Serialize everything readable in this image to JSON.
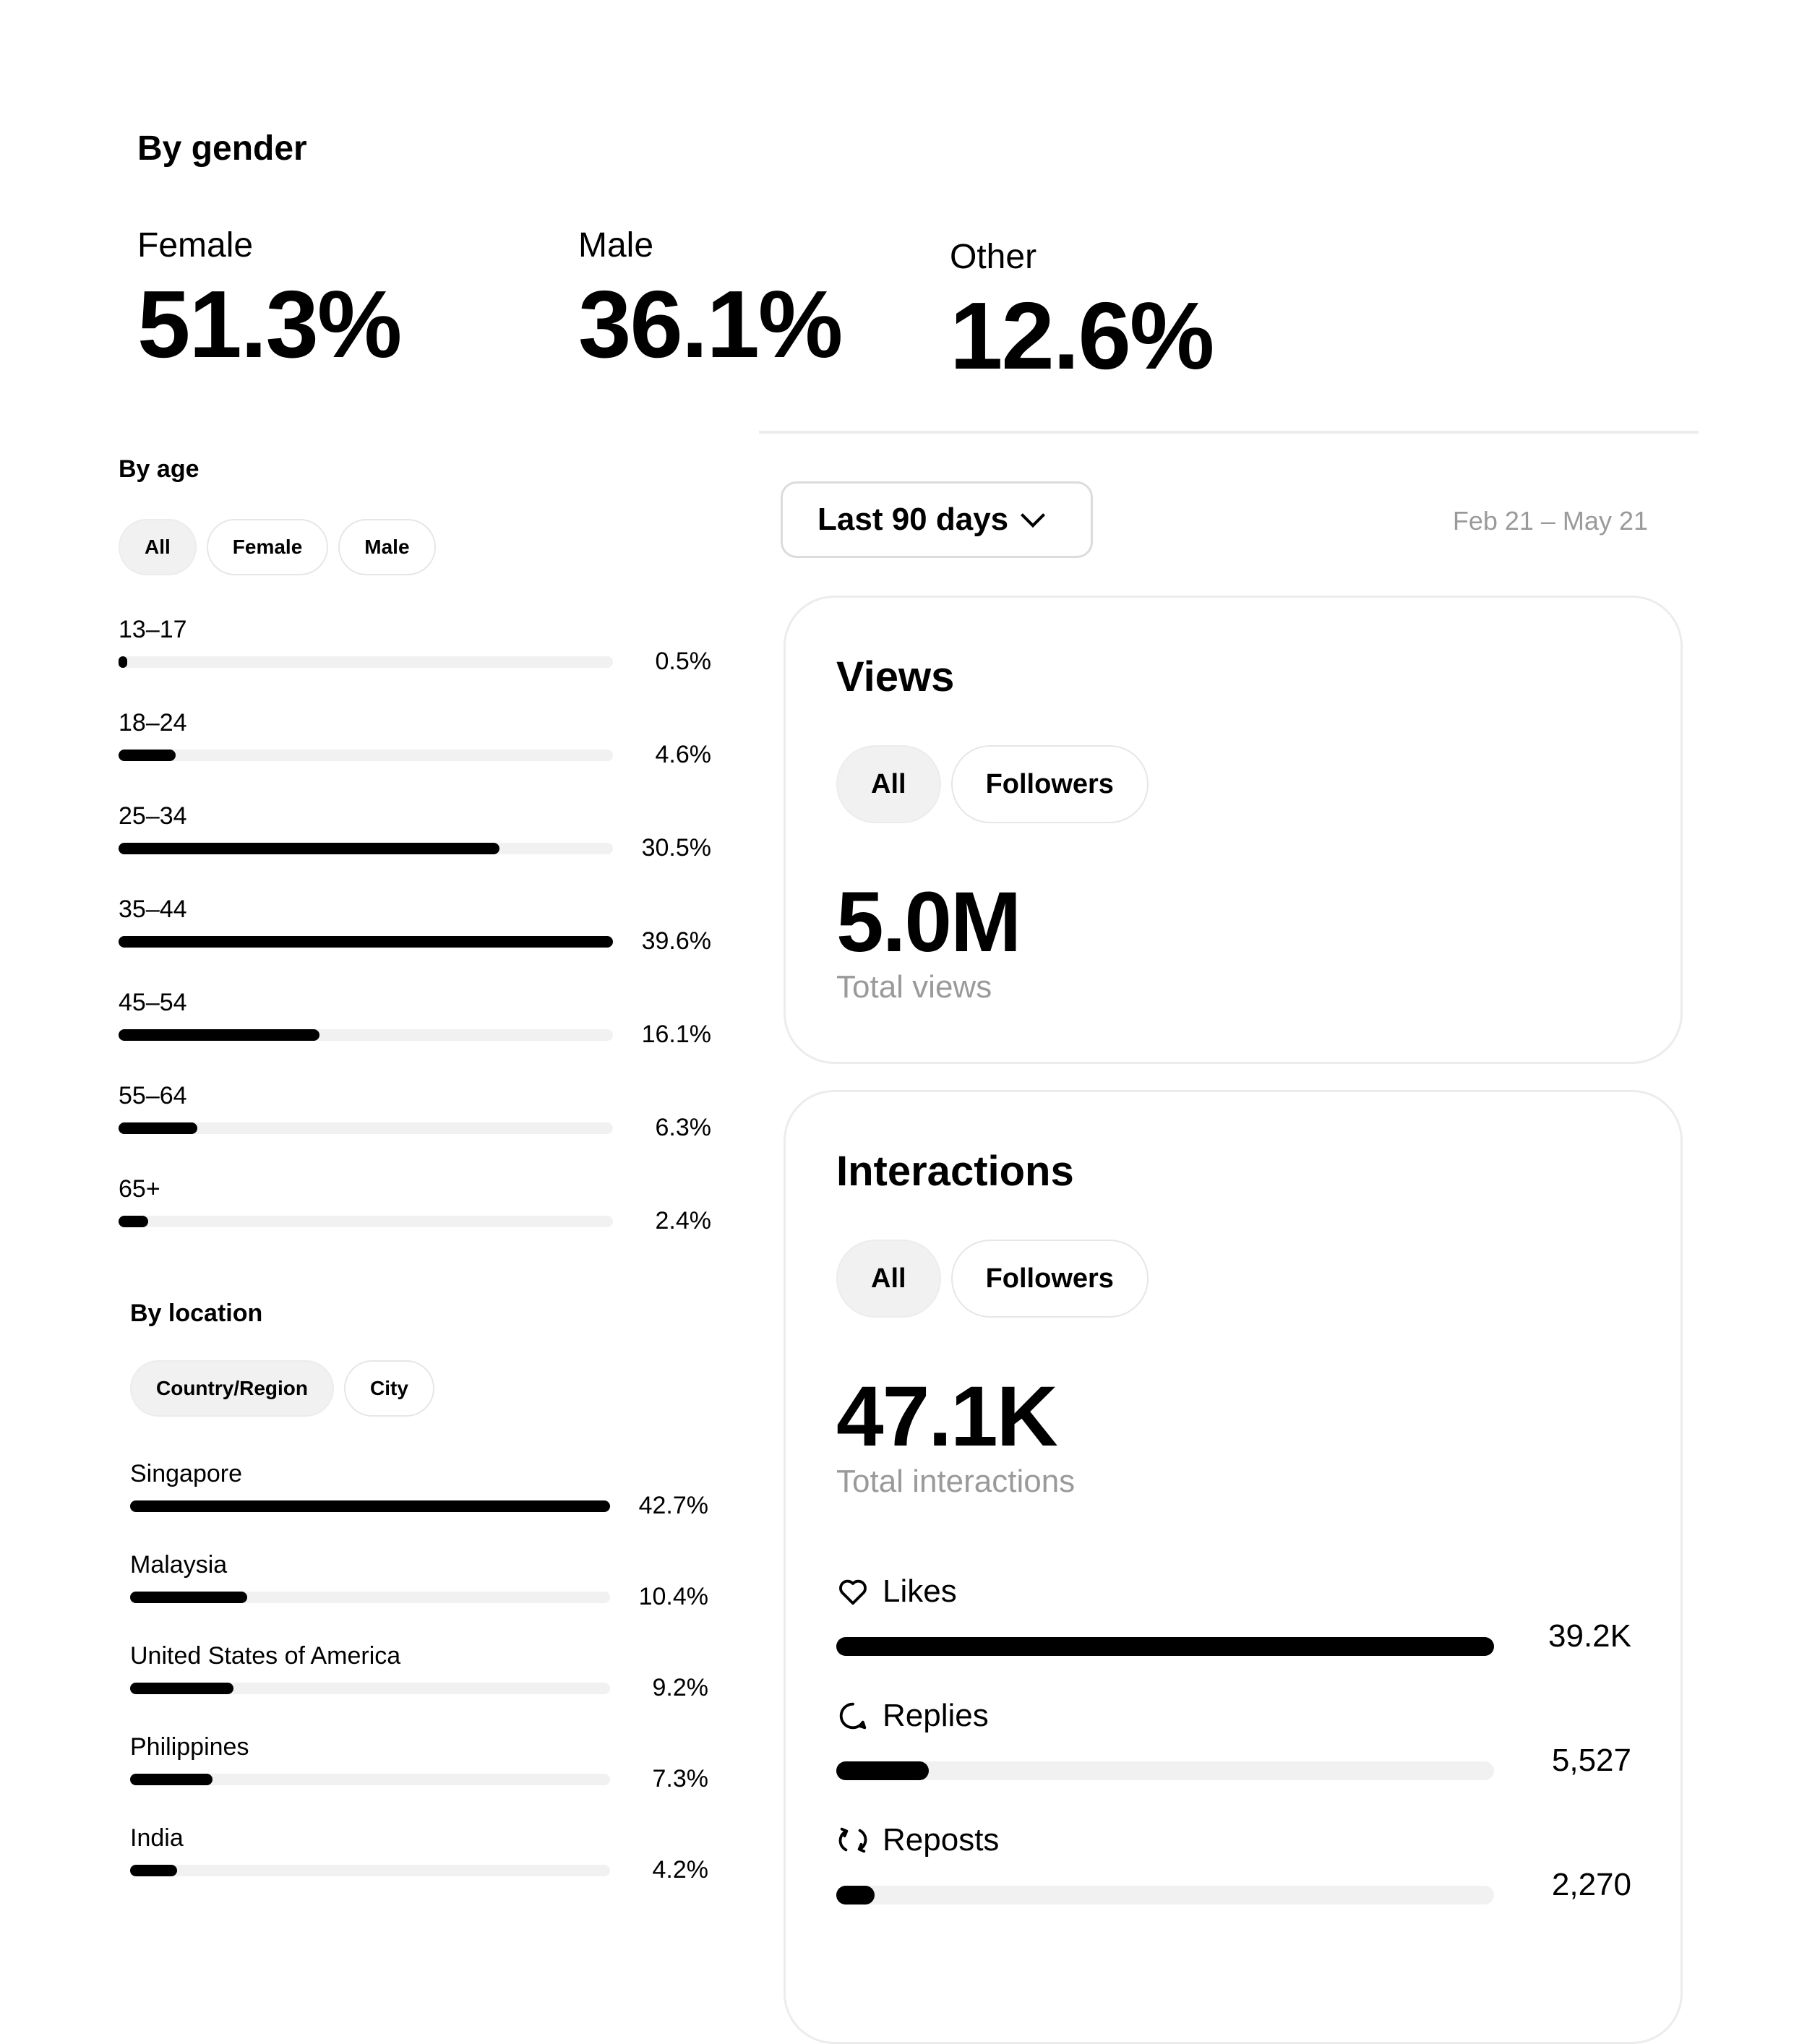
{
  "gender": {
    "title": "By gender",
    "items": [
      {
        "label": "Female",
        "value": "51.3%"
      },
      {
        "label": "Male",
        "value": "36.1%"
      },
      {
        "label": "Other",
        "value": "12.6%"
      }
    ]
  },
  "age": {
    "title": "By age",
    "filters": [
      "All",
      "Female",
      "Male"
    ],
    "active_filter": "All",
    "rows": [
      {
        "label": "13–17",
        "value": "0.5%",
        "pct": 0.5
      },
      {
        "label": "18–24",
        "value": "4.6%",
        "pct": 4.6
      },
      {
        "label": "25–34",
        "value": "30.5%",
        "pct": 30.5
      },
      {
        "label": "35–44",
        "value": "39.6%",
        "pct": 39.6
      },
      {
        "label": "45–54",
        "value": "16.1%",
        "pct": 16.1
      },
      {
        "label": "55–64",
        "value": "6.3%",
        "pct": 6.3
      },
      {
        "label": "65+",
        "value": "2.4%",
        "pct": 2.4
      }
    ]
  },
  "location": {
    "title": "By location",
    "filters": [
      "Country/Region",
      "City"
    ],
    "active_filter": "Country/Region",
    "rows": [
      {
        "label": "Singapore",
        "value": "42.7%",
        "pct": 42.7
      },
      {
        "label": "Malaysia",
        "value": "10.4%",
        "pct": 10.4
      },
      {
        "label": "United States of America",
        "value": "9.2%",
        "pct": 9.2
      },
      {
        "label": "Philippines",
        "value": "7.3%",
        "pct": 7.3
      },
      {
        "label": "India",
        "value": "4.2%",
        "pct": 4.2
      }
    ]
  },
  "range": {
    "label": "Last 90 days",
    "dates": "Feb 21 – May 21"
  },
  "views": {
    "title": "Views",
    "filters": [
      "All",
      "Followers"
    ],
    "active_filter": "All",
    "value": "5.0M",
    "caption": "Total views"
  },
  "interactions": {
    "title": "Interactions",
    "filters": [
      "All",
      "Followers"
    ],
    "active_filter": "All",
    "value": "47.1K",
    "caption": "Total interactions",
    "rows": [
      {
        "label": "Likes",
        "icon": "heart-icon",
        "value": "39.2K",
        "amount": 39200
      },
      {
        "label": "Replies",
        "icon": "reply-icon",
        "value": "5,527",
        "amount": 5527
      },
      {
        "label": "Reposts",
        "icon": "repost-icon",
        "value": "2,270",
        "amount": 2270
      }
    ]
  }
}
